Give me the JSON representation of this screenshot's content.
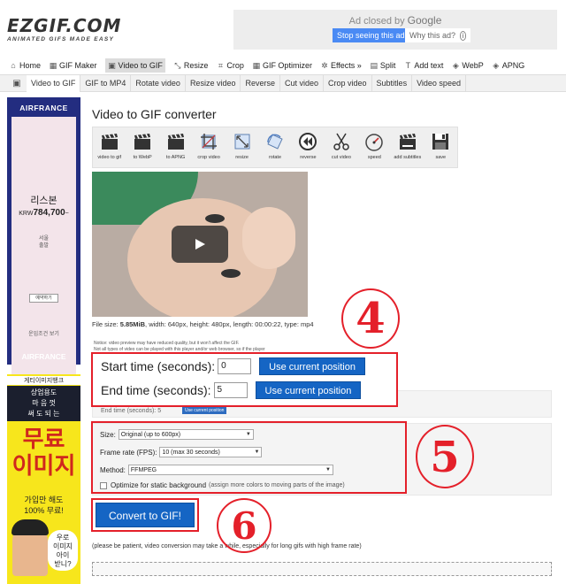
{
  "header": {
    "logo_main": "EZGIF.COM",
    "logo_sub": "ANIMATED GIFS MADE EASY"
  },
  "ad_top": {
    "closed_by": "Ad closed by",
    "google": "Google",
    "stop_label": "Stop seeing this ad",
    "why_label": "Why this ad?",
    "info_glyph": "i"
  },
  "main_nav": [
    {
      "label": "Home",
      "icon": "home-icon",
      "glyph": "⌂",
      "active": false
    },
    {
      "label": "GIF Maker",
      "icon": "gif-maker-icon",
      "glyph": "▦",
      "active": false
    },
    {
      "label": "Video to GIF",
      "icon": "video-icon",
      "glyph": "▣",
      "active": true
    },
    {
      "label": "Resize",
      "icon": "resize-icon",
      "glyph": "⤡",
      "active": false
    },
    {
      "label": "Crop",
      "icon": "crop-icon",
      "glyph": "⌗",
      "active": false
    },
    {
      "label": "GIF Optimizer",
      "icon": "optimizer-icon",
      "glyph": "▦",
      "active": false
    },
    {
      "label": "Effects »",
      "icon": "effects-icon",
      "glyph": "✲",
      "active": false
    },
    {
      "label": "Split",
      "icon": "split-icon",
      "glyph": "▤",
      "active": false
    },
    {
      "label": "Add text",
      "icon": "add-text-icon",
      "glyph": "T",
      "active": false
    },
    {
      "label": "WebP",
      "icon": "webp-icon",
      "glyph": "◈",
      "active": false
    },
    {
      "label": "APNG",
      "icon": "apng-icon",
      "glyph": "◈",
      "active": false
    }
  ],
  "sub_nav": {
    "icon_glyph": "▣",
    "items": [
      {
        "label": "Video to GIF",
        "active": true
      },
      {
        "label": "GIF to MP4",
        "active": false
      },
      {
        "label": "Rotate video",
        "active": false
      },
      {
        "label": "Resize video",
        "active": false
      },
      {
        "label": "Reverse",
        "active": false
      },
      {
        "label": "Cut video",
        "active": false
      },
      {
        "label": "Crop video",
        "active": false
      },
      {
        "label": "Subtitles",
        "active": false
      },
      {
        "label": "Video speed",
        "active": false
      }
    ]
  },
  "ad_left1": {
    "brand": "AIRFRANCE",
    "city": "리스본",
    "currency": "KRW",
    "price": "784,700",
    "suffix": "~",
    "line1": "서울",
    "line2": "출발",
    "button": "예약하기",
    "footer_note": "운임조건 보기",
    "brand_bottom": "AIRFRANCE"
  },
  "ad_left2": {
    "top": "게티이미지뱅크",
    "line1": "상업용도",
    "line2": "마 음 껏",
    "line3": "써 도 되 는",
    "big1": "무료",
    "big2": "이미지",
    "mid1": "가입만 해도",
    "mid2": "100% 무료!",
    "bubble1": "우로",
    "bubble2": "이미지",
    "bubble3": "아이",
    "bubble4": "받니?"
  },
  "page_title": "Video to GIF converter",
  "toolbar": [
    {
      "label": "video to gif",
      "icon": "clapper-icon"
    },
    {
      "label": "to WebP",
      "icon": "clapper-webp-icon"
    },
    {
      "label": "to APNG",
      "icon": "clapper-apng-icon"
    },
    {
      "label": "crop video",
      "icon": "crop-video-icon"
    },
    {
      "label": "resize",
      "icon": "resize-video-icon"
    },
    {
      "label": "rotate",
      "icon": "rotate-icon"
    },
    {
      "label": "reverse",
      "icon": "reverse-icon"
    },
    {
      "label": "cut video",
      "icon": "scissors-icon"
    },
    {
      "label": "speed",
      "icon": "speed-icon"
    },
    {
      "label": "add subtitles",
      "icon": "subtitles-icon"
    },
    {
      "label": "save",
      "icon": "save-icon"
    }
  ],
  "file_info": {
    "prefix": "File size: ",
    "size": "5.85MiB",
    "rest": ", width: 640px, height: 480px, length: 00:00:22, type: mp4"
  },
  "notice": {
    "line1": "Notice: video preview may have reduced quality, but it won't affect the GIF.",
    "line2": "Not all types of video can be played with this player and/or web browser, so if the player"
  },
  "time": {
    "start_label": "Start time (seconds):",
    "start_value": "0",
    "end_label": "End time (seconds):",
    "end_value": "5",
    "use_current": "Use current position"
  },
  "ghost": {
    "label": "End time (seconds):",
    "value": "5",
    "button": "Use current position"
  },
  "options": {
    "size_label": "Size:",
    "size_value": "Original (up to 600px)",
    "fps_label": "Frame rate (FPS):",
    "fps_value": "10 (max 30 seconds)",
    "method_label": "Method:",
    "method_value": "FFMPEG",
    "optimize_label": "Optimize for static background",
    "optimize_note": "(assign more colors to moving parts of the image)"
  },
  "convert_label": "Convert to GIF!",
  "patience_note": "(please be patient, video conversion may take a while, especially for long gifs with high frame rate)",
  "annotations": {
    "step4": "4",
    "step5": "5",
    "step6": "6"
  },
  "colors": {
    "accent_blue": "#1565c4",
    "annotation_red": "#e4202a",
    "airfrance_navy": "#232d80",
    "ad_yellow": "#f7e61c"
  }
}
